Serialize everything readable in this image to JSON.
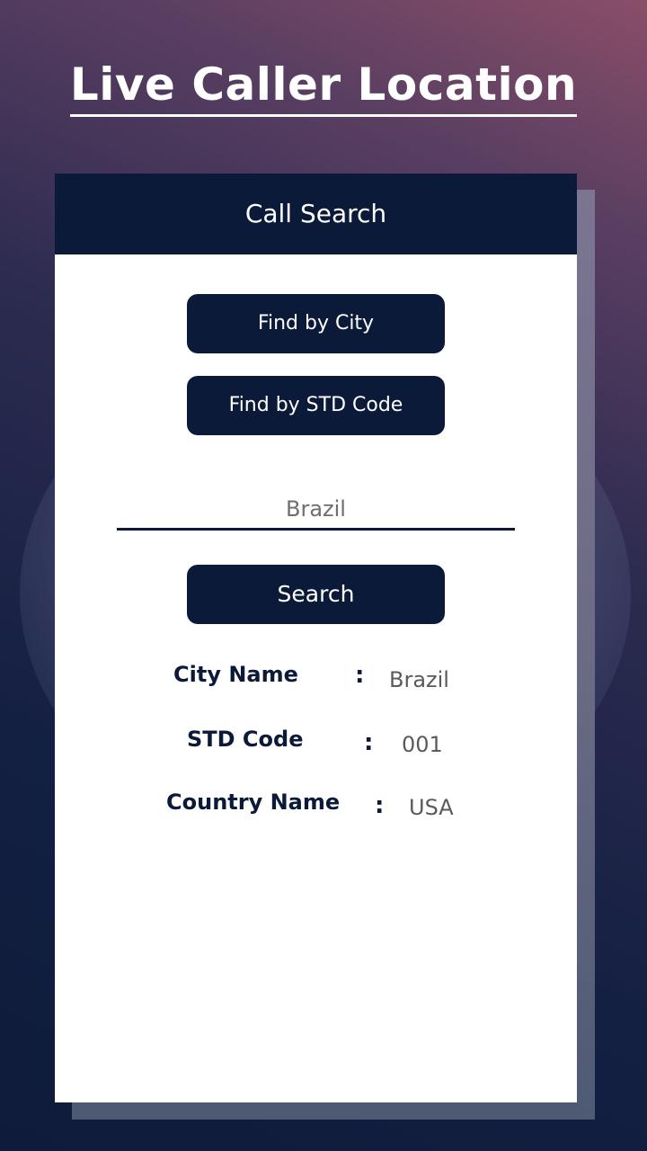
{
  "app_title": "Live Caller Location",
  "card": {
    "header_title": "Call Search",
    "find_by_city_label": "Find by City",
    "find_by_std_label": "Find by STD Code",
    "search_input_value": "Brazil",
    "search_button_label": "Search"
  },
  "results": {
    "separator": ":",
    "rows": [
      {
        "label": "City Name",
        "value": "Brazil"
      },
      {
        "label": "STD Code",
        "value": "001"
      },
      {
        "label": "Country Name",
        "value": "USA"
      }
    ]
  },
  "colors": {
    "primary_navy": "#0c1a3a",
    "card_background": "#ffffff",
    "value_text": "#5a5a5a"
  }
}
